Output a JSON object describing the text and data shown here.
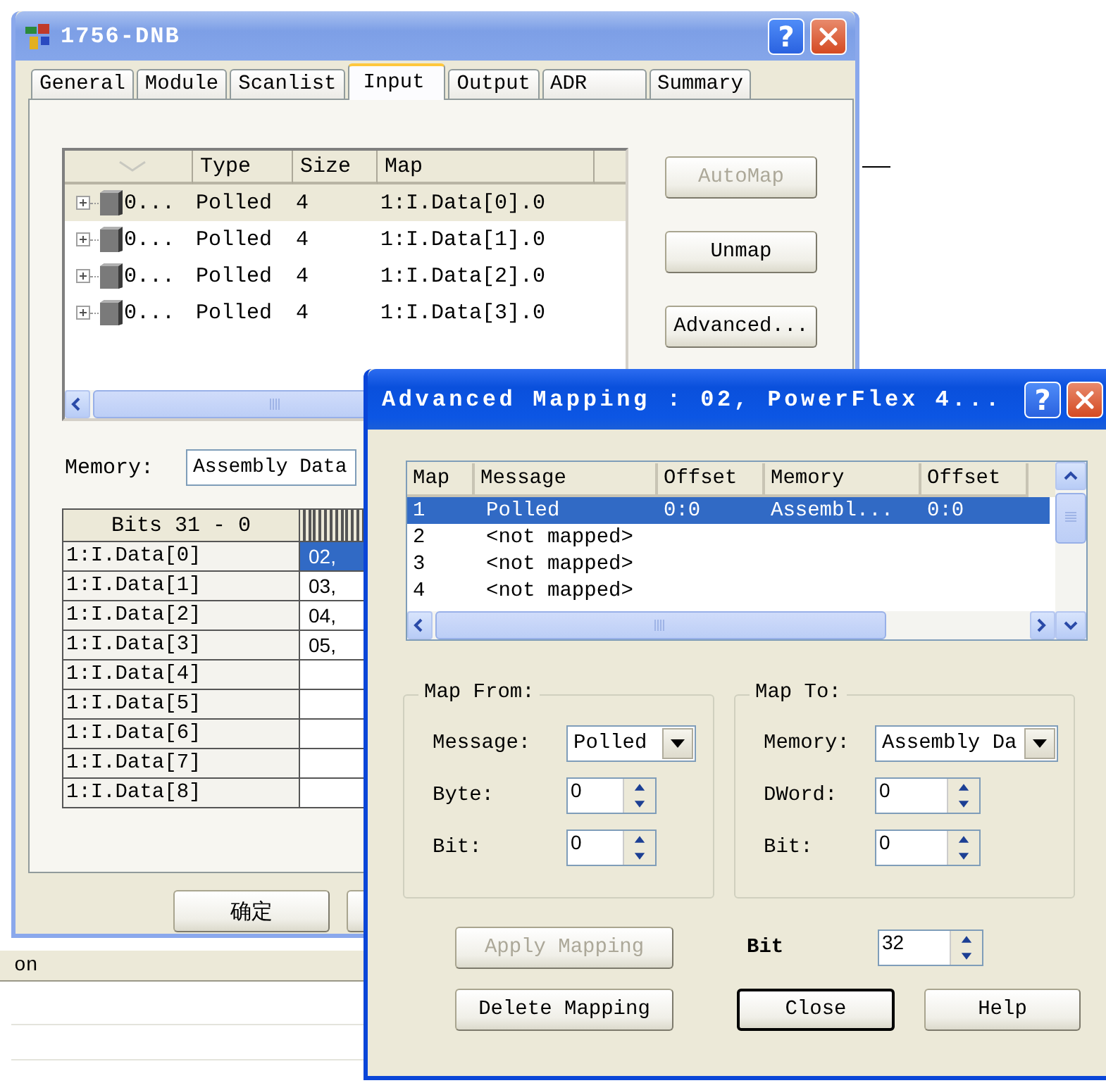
{
  "main_window": {
    "title": "1756-DNB",
    "help_button": "?",
    "tabs": [
      {
        "label": "General",
        "selected": false
      },
      {
        "label": "Module",
        "selected": false
      },
      {
        "label": "Scanlist",
        "selected": false
      },
      {
        "label": "Input",
        "selected": true
      },
      {
        "label": "Output",
        "selected": false
      },
      {
        "label": "ADR",
        "selected": false
      },
      {
        "label": "Summary",
        "selected": false
      }
    ],
    "input_list": {
      "columns": [
        "Type",
        "Size",
        "Map"
      ],
      "rows": [
        {
          "name": "0...",
          "type": "Polled",
          "size": "4",
          "map": "1:I.Data[0].0",
          "selected": true
        },
        {
          "name": "0...",
          "type": "Polled",
          "size": "4",
          "map": "1:I.Data[1].0",
          "selected": false
        },
        {
          "name": "0...",
          "type": "Polled",
          "size": "4",
          "map": "1:I.Data[2].0",
          "selected": false
        },
        {
          "name": "0...",
          "type": "Polled",
          "size": "4",
          "map": "1:I.Data[3].0",
          "selected": false
        }
      ]
    },
    "buttons": [
      {
        "label": "AutoMap",
        "disabled": true
      },
      {
        "label": "Unmap",
        "disabled": false
      },
      {
        "label": "Advanced...",
        "disabled": false
      }
    ],
    "memory": {
      "label": "Memory:",
      "value": "Assembly Data"
    },
    "bits_grid": {
      "header": "Bits 31 - 0",
      "rows": [
        {
          "label": "1:I.Data[0]",
          "value": "02,",
          "selected": true
        },
        {
          "label": "1:I.Data[1]",
          "value": "03,",
          "selected": false
        },
        {
          "label": "1:I.Data[2]",
          "value": "04,",
          "selected": false
        },
        {
          "label": "1:I.Data[3]",
          "value": "05,",
          "selected": false
        },
        {
          "label": "1:I.Data[4]",
          "selected": false
        },
        {
          "label": "1:I.Data[5]",
          "selected": false
        },
        {
          "label": "1:I.Data[6]",
          "selected": false
        },
        {
          "label": "1:I.Data[7]",
          "selected": false
        },
        {
          "label": "1:I.Data[8]",
          "selected": false
        }
      ]
    },
    "ok_button": "确定"
  },
  "status_bar": {
    "text": "on"
  },
  "advanced_dialog": {
    "title": "Advanced Mapping : 02, PowerFlex 4...",
    "help_button": "?",
    "table": {
      "columns": [
        "Map",
        "Message",
        "Offset",
        "Memory",
        "Offset"
      ],
      "rows": [
        {
          "cells": [
            "1",
            "Polled",
            "0:0",
            "Assembl...",
            "0:0"
          ],
          "selected": true
        },
        {
          "cells": [
            "2",
            "<not mapped>"
          ],
          "selected": false
        },
        {
          "cells": [
            "3",
            "<not mapped>"
          ],
          "selected": false
        },
        {
          "cells": [
            "4",
            "<not mapped>"
          ],
          "selected": false
        }
      ]
    },
    "map_from": {
      "title": "Map From:",
      "fields": [
        {
          "kind": "combo",
          "label": "Message:",
          "value": "Polled"
        },
        {
          "kind": "spin",
          "label": "Byte:",
          "value": "0"
        },
        {
          "kind": "spin",
          "label": "Bit:",
          "value": "0"
        }
      ]
    },
    "map_to": {
      "title": "Map To:",
      "fields": [
        {
          "kind": "combo",
          "label": "Memory:",
          "value": "Assembly Da"
        },
        {
          "kind": "spin",
          "label": "DWord:",
          "value": "0"
        },
        {
          "kind": "spin",
          "label": "Bit:",
          "value": "0"
        }
      ]
    },
    "apply_button": {
      "label": "Apply Mapping",
      "disabled": true
    },
    "bit": {
      "label": "Bit",
      "value": "32"
    },
    "buttons": [
      {
        "label": "Delete Mapping",
        "default": false
      },
      {
        "label": "Close",
        "default": true
      },
      {
        "label": "Help",
        "default": false
      }
    ]
  }
}
